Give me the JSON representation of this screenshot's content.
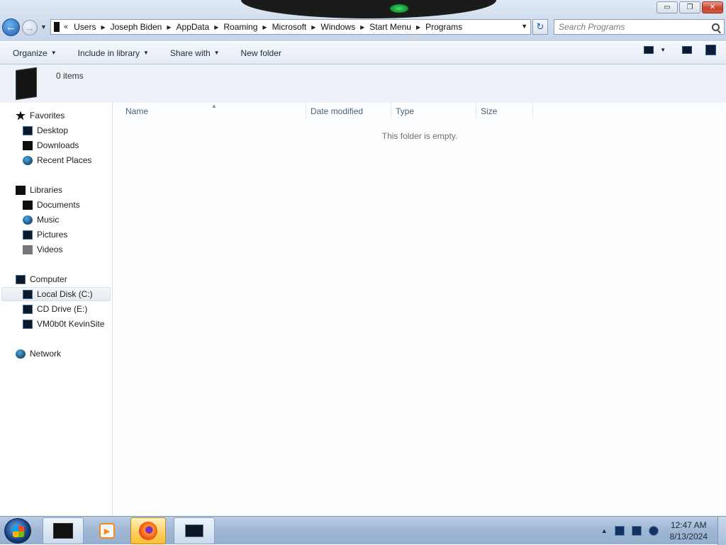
{
  "window": {
    "controls": {
      "minimize": "▭",
      "restore": "❐",
      "close": "✕"
    }
  },
  "nav": {
    "back_icon": "back-arrow-icon",
    "forward_icon": "forward-arrow-icon"
  },
  "address": {
    "lead": "«",
    "crumbs": [
      "Users",
      "Joseph Biden",
      "AppData",
      "Roaming",
      "Microsoft",
      "Windows",
      "Start Menu",
      "Programs"
    ]
  },
  "search": {
    "placeholder": "Search Programs"
  },
  "toolbar": {
    "organize": "Organize",
    "include_in_library": "Include in library",
    "share_with": "Share with",
    "new_folder": "New folder"
  },
  "details": {
    "items_count": "0 items"
  },
  "sidebar": {
    "favorites": {
      "label": "Favorites",
      "items": [
        "Desktop",
        "Downloads",
        "Recent Places"
      ]
    },
    "libraries": {
      "label": "Libraries",
      "items": [
        "Documents",
        "Music",
        "Pictures",
        "Videos"
      ]
    },
    "computer": {
      "label": "Computer",
      "items": [
        "Local Disk (C:)",
        "CD Drive (E:)",
        "VM0b0t KevinSite"
      ],
      "selected": "Local Disk (C:)"
    },
    "network": {
      "label": "Network"
    }
  },
  "columns": [
    "Name",
    "Date modified",
    "Type",
    "Size"
  ],
  "content": {
    "empty_message": "This folder is empty."
  },
  "taskbar": {
    "clock_time": "12:47 AM",
    "clock_date": "8/13/2024"
  },
  "colors": {
    "accent": "#1d5fb0",
    "taskbar": "#9fb7d3",
    "selected_highlight": "#ffd36b"
  }
}
